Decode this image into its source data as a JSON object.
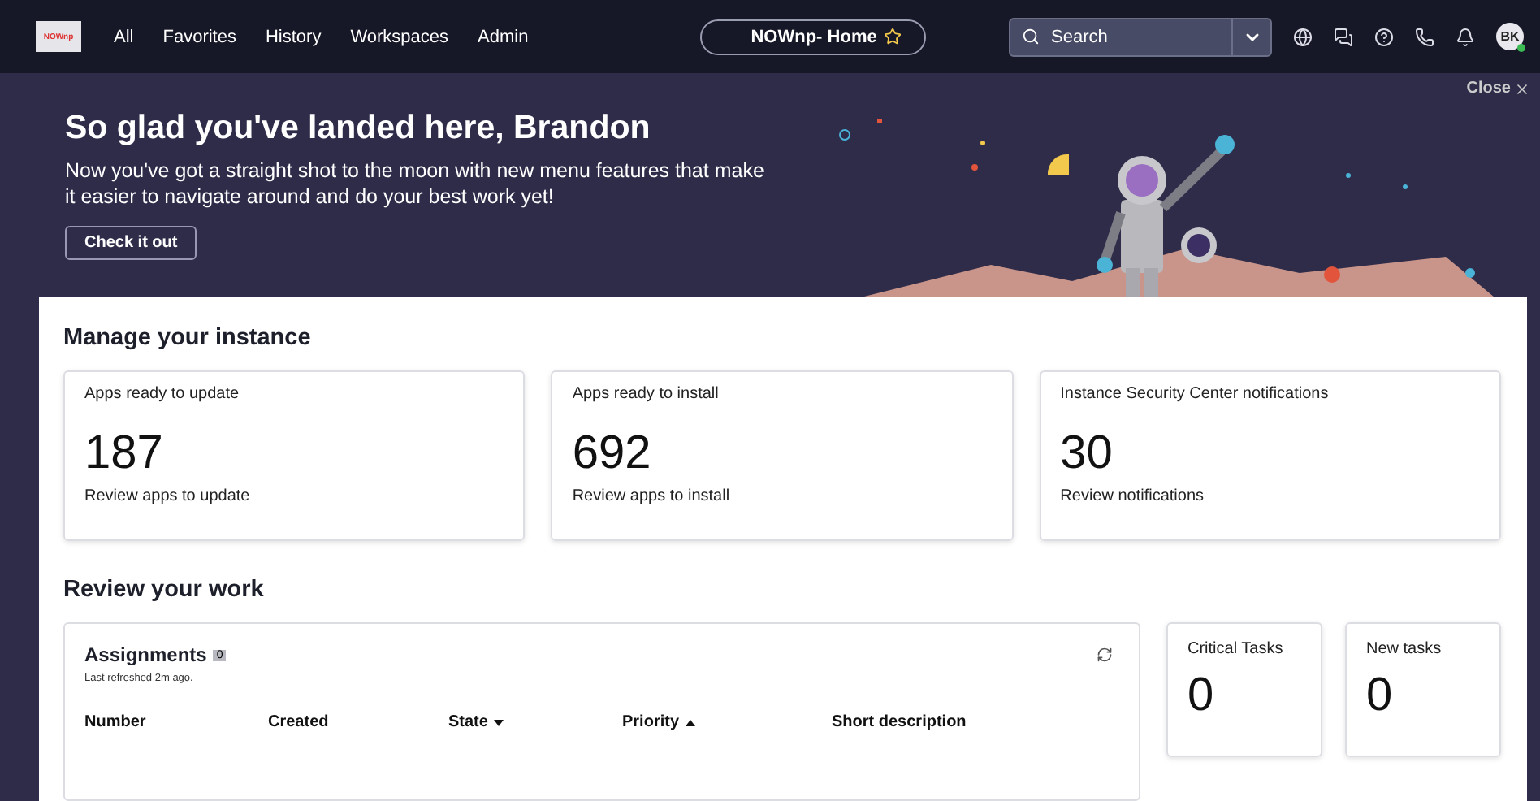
{
  "nav": {
    "logo": "NOWnp",
    "menu": [
      {
        "label": "All"
      },
      {
        "label": "Favorites"
      },
      {
        "label": "History"
      },
      {
        "label": "Workspaces"
      },
      {
        "label": "Admin"
      }
    ],
    "page_pill": {
      "label": "NOWnp- Home",
      "starred": false
    },
    "search": {
      "placeholder": "Search"
    },
    "avatar": {
      "initials": "BK",
      "online": true
    }
  },
  "banner": {
    "title": "So glad you've landed here, Brandon",
    "text": "Now you've got a straight shot to the moon with new menu features that make it easier to navigate around and do your best work yet!",
    "button": "Check it out",
    "close": "Close"
  },
  "manage": {
    "heading": "Manage your instance",
    "cards": [
      {
        "title": "Apps ready to update",
        "count": "187",
        "link": "Review apps to update"
      },
      {
        "title": "Apps ready to install",
        "count": "692",
        "link": "Review apps to install"
      },
      {
        "title": "Instance Security Center notifications",
        "count": "30",
        "link": "Review notifications"
      }
    ]
  },
  "review": {
    "heading": "Review your work",
    "assignments": {
      "title": "Assignments",
      "badge": "0",
      "refreshed": "Last refreshed 2m ago.",
      "columns": [
        {
          "label": "Number",
          "sorted": false
        },
        {
          "label": "Created",
          "sorted": false
        },
        {
          "label": "State",
          "sorted": true,
          "ascending": false
        },
        {
          "label": "Priority",
          "sorted": true,
          "ascending": true
        },
        {
          "label": "Short description",
          "sorted": false
        }
      ]
    },
    "tasks": [
      {
        "title": "Critical Tasks",
        "count": "0"
      },
      {
        "title": "New tasks",
        "count": "0"
      }
    ]
  }
}
